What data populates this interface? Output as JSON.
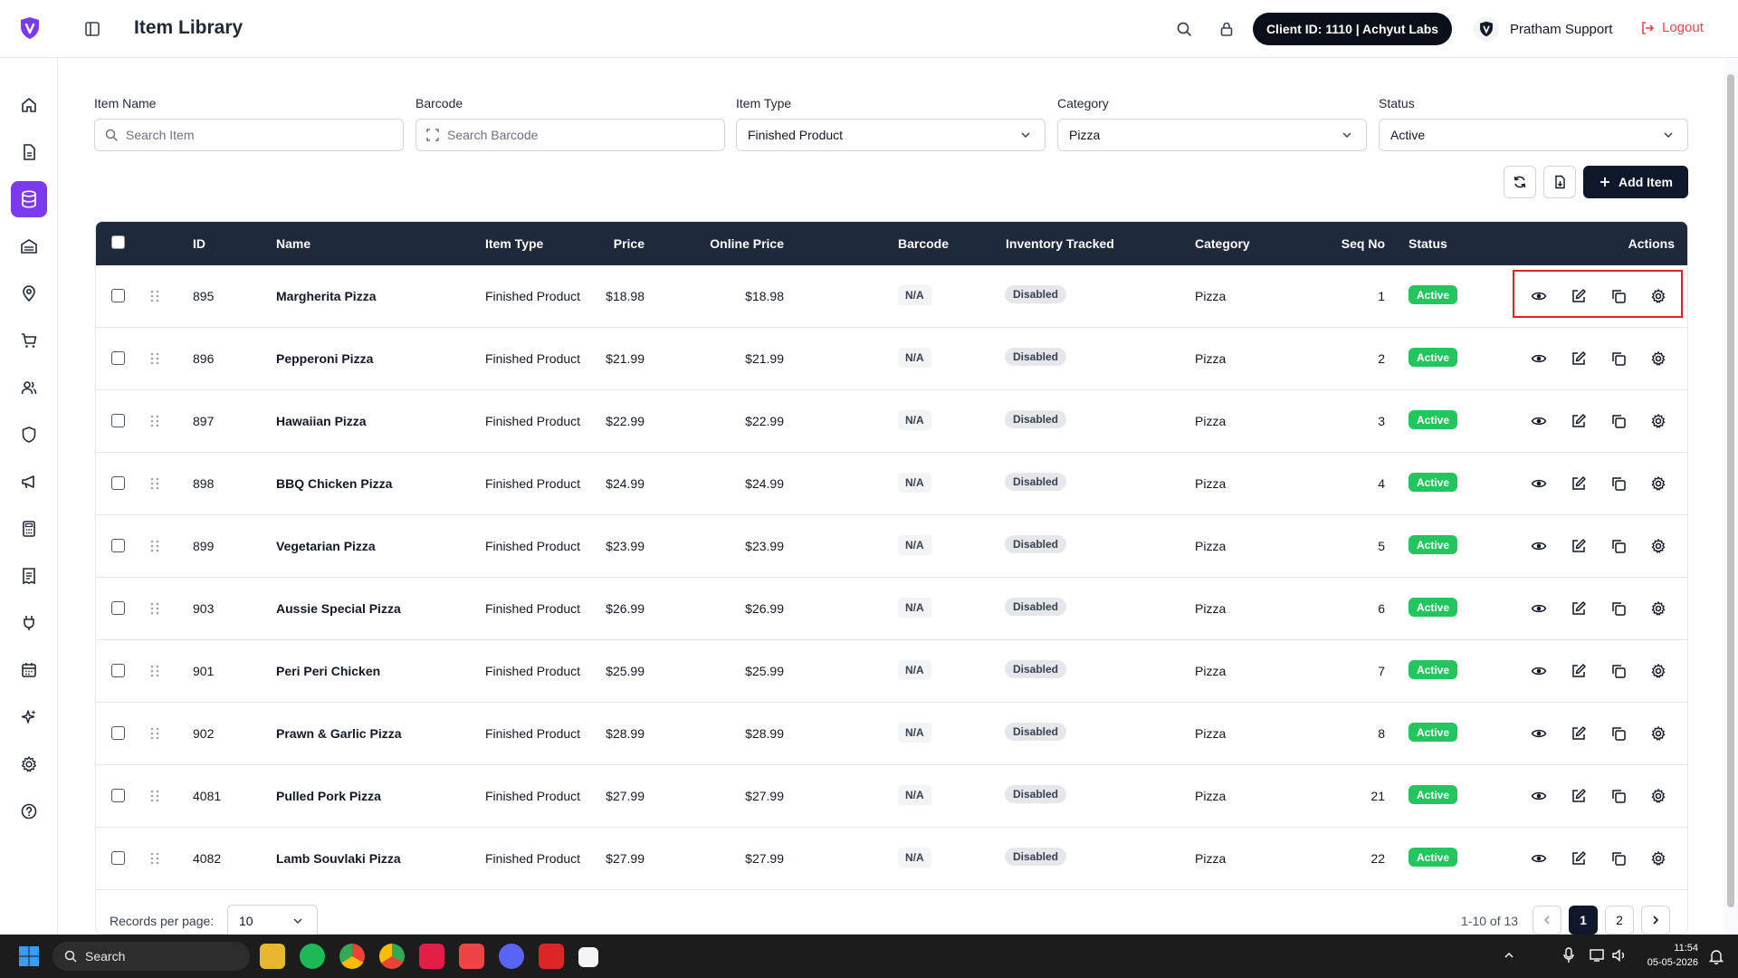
{
  "header": {
    "title": "Item Library",
    "client_label": "Client ID: 1110 | Achyut Labs",
    "user_name": "Pratham Support",
    "logout_label": "Logout"
  },
  "filters": {
    "item_name": {
      "label": "Item Name",
      "placeholder": "Search Item"
    },
    "barcode": {
      "label": "Barcode",
      "placeholder": "Search Barcode"
    },
    "item_type": {
      "label": "Item Type",
      "value": "Finished Product"
    },
    "category": {
      "label": "Category",
      "value": "Pizza"
    },
    "status": {
      "label": "Status",
      "value": "Active"
    }
  },
  "toolbar": {
    "add_label": "Add Item"
  },
  "table": {
    "columns": [
      "ID",
      "Name",
      "Item Type",
      "Price",
      "Online Price",
      "Barcode",
      "Inventory Tracked",
      "Category",
      "Seq No",
      "Status",
      "Actions"
    ],
    "rows": [
      {
        "id": "895",
        "name": "Margherita Pizza",
        "type": "Finished Product",
        "price": "$18.98",
        "online_price": "$18.98",
        "barcode": "N/A",
        "inventory": "Disabled",
        "category": "Pizza",
        "seq": "1",
        "status": "Active"
      },
      {
        "id": "896",
        "name": "Pepperoni Pizza",
        "type": "Finished Product",
        "price": "$21.99",
        "online_price": "$21.99",
        "barcode": "N/A",
        "inventory": "Disabled",
        "category": "Pizza",
        "seq": "2",
        "status": "Active"
      },
      {
        "id": "897",
        "name": "Hawaiian Pizza",
        "type": "Finished Product",
        "price": "$22.99",
        "online_price": "$22.99",
        "barcode": "N/A",
        "inventory": "Disabled",
        "category": "Pizza",
        "seq": "3",
        "status": "Active"
      },
      {
        "id": "898",
        "name": "BBQ Chicken Pizza",
        "type": "Finished Product",
        "price": "$24.99",
        "online_price": "$24.99",
        "barcode": "N/A",
        "inventory": "Disabled",
        "category": "Pizza",
        "seq": "4",
        "status": "Active"
      },
      {
        "id": "899",
        "name": "Vegetarian Pizza",
        "type": "Finished Product",
        "price": "$23.99",
        "online_price": "$23.99",
        "barcode": "N/A",
        "inventory": "Disabled",
        "category": "Pizza",
        "seq": "5",
        "status": "Active"
      },
      {
        "id": "903",
        "name": "Aussie Special Pizza",
        "type": "Finished Product",
        "price": "$26.99",
        "online_price": "$26.99",
        "barcode": "N/A",
        "inventory": "Disabled",
        "category": "Pizza",
        "seq": "6",
        "status": "Active"
      },
      {
        "id": "901",
        "name": "Peri Peri Chicken",
        "type": "Finished Product",
        "price": "$25.99",
        "online_price": "$25.99",
        "barcode": "N/A",
        "inventory": "Disabled",
        "category": "Pizza",
        "seq": "7",
        "status": "Active"
      },
      {
        "id": "902",
        "name": "Prawn & Garlic Pizza",
        "type": "Finished Product",
        "price": "$28.99",
        "online_price": "$28.99",
        "barcode": "N/A",
        "inventory": "Disabled",
        "category": "Pizza",
        "seq": "8",
        "status": "Active"
      },
      {
        "id": "4081",
        "name": "Pulled Pork Pizza",
        "type": "Finished Product",
        "price": "$27.99",
        "online_price": "$27.99",
        "barcode": "N/A",
        "inventory": "Disabled",
        "category": "Pizza",
        "seq": "21",
        "status": "Active"
      },
      {
        "id": "4082",
        "name": "Lamb Souvlaki Pizza",
        "type": "Finished Product",
        "price": "$27.99",
        "online_price": "$27.99",
        "barcode": "N/A",
        "inventory": "Disabled",
        "category": "Pizza",
        "seq": "22",
        "status": "Active"
      }
    ]
  },
  "pagination": {
    "records_label": "Records per page:",
    "records_value": "10",
    "range": "1-10 of 13",
    "pages": [
      "1",
      "2"
    ],
    "current_page": "1"
  },
  "taskbar": {
    "search_label": "Search",
    "time": "11:54",
    "date": "05-05-2026"
  },
  "colors": {
    "brand": "#7c3aed",
    "header_dark": "#1e293b",
    "active_green": "#22c55e",
    "logout_red": "#ef4444",
    "highlight_red": "#dc2626"
  }
}
